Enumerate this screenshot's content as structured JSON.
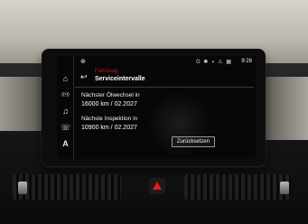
{
  "statusbar": {
    "time": "9:28",
    "icons": "G ✱ ◖ ⚠ ▦"
  },
  "header": {
    "crumb": "Fahrzeug",
    "title": "Serviceintervalle"
  },
  "service": {
    "oil_label": "Nächster Ölwechsel in",
    "oil_value": "16000 km / 02.2027",
    "inspection_label": "Nächste Inspektion in",
    "inspection_value": "10900 km / 02.2027"
  },
  "actions": {
    "reset_label": "Zurücksetzen"
  },
  "sidebar": {
    "items": [
      {
        "icon": "home-icon",
        "glyph": "⌂"
      },
      {
        "icon": "radio-icon",
        "glyph": "((•))"
      },
      {
        "icon": "music-icon",
        "glyph": "♫"
      },
      {
        "icon": "phone-icon",
        "glyph": "☏"
      },
      {
        "icon": "navigation-icon",
        "glyph": "A"
      }
    ]
  },
  "colors": {
    "accent": "#d0131b",
    "screen_bg": "#070707",
    "text": "#ffffff"
  }
}
